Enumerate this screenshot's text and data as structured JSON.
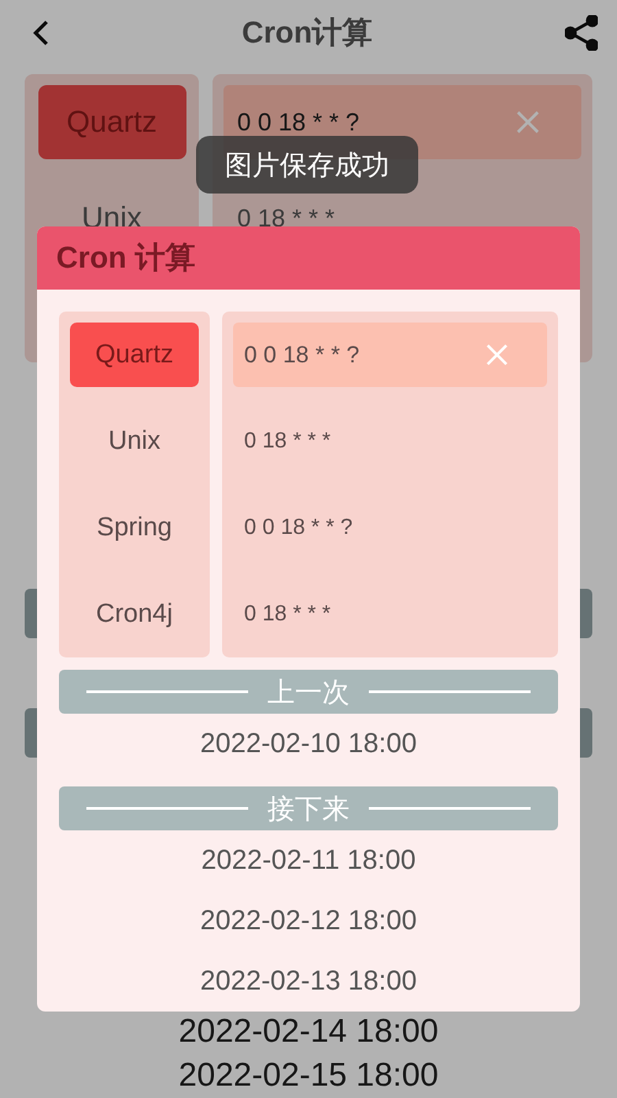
{
  "page": {
    "title": "Cron计算",
    "formats": [
      {
        "name": "Quartz",
        "selected": true
      },
      {
        "name": "Unix",
        "selected": false
      }
    ],
    "input": "0 0 18 * * ?",
    "outputs": [
      "0 18 * * *"
    ],
    "dates": [
      "2022-02-14 18:00",
      "2022-02-15 18:00"
    ]
  },
  "dialog": {
    "title": "Cron 计算",
    "formats": [
      {
        "name": "Quartz",
        "selected": true
      },
      {
        "name": "Unix",
        "selected": false
      },
      {
        "name": "Spring",
        "selected": false
      },
      {
        "name": "Cron4j",
        "selected": false
      }
    ],
    "input": "0 0 18 * * ?",
    "outputs": [
      "0 18 * * *",
      "0 0 18 * * ?",
      "0 18 * * *"
    ],
    "previous_label": "上一次",
    "previous": [
      "2022-02-10 18:00"
    ],
    "next_label": "接下来",
    "next": [
      "2022-02-11 18:00",
      "2022-02-12 18:00",
      "2022-02-13 18:00"
    ]
  },
  "toast": "图片保存成功"
}
